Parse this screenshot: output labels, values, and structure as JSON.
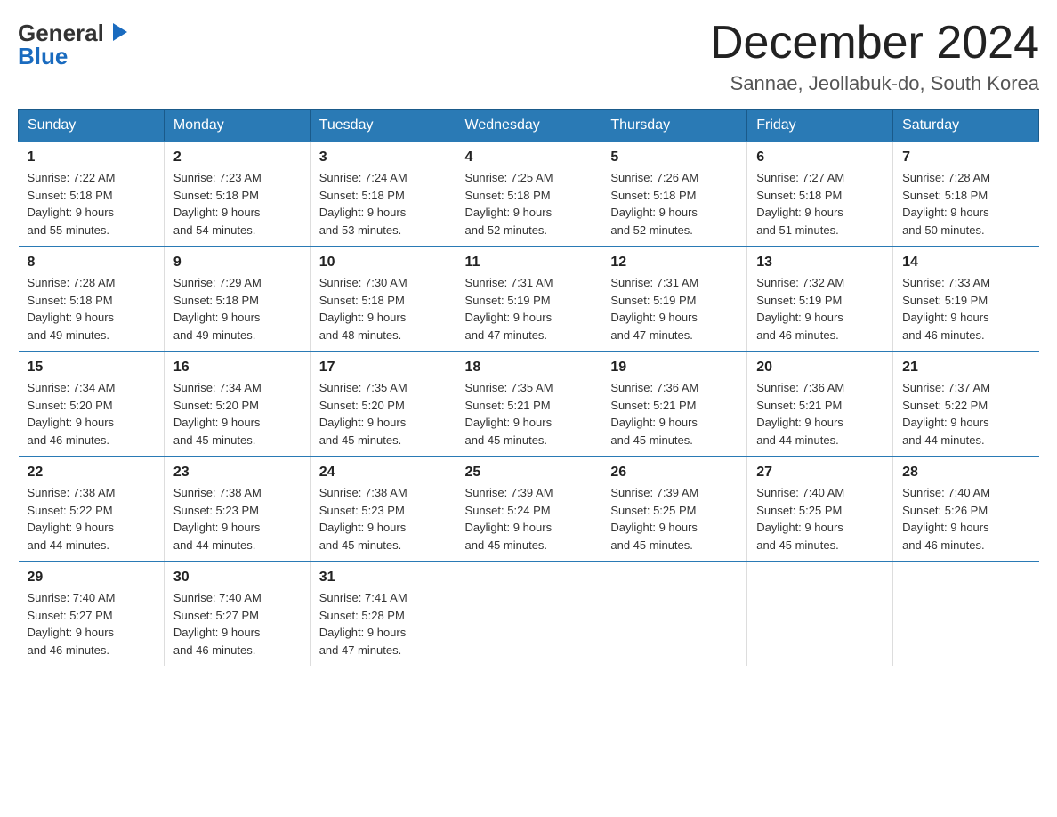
{
  "header": {
    "logo_general": "General",
    "logo_blue": "Blue",
    "month_title": "December 2024",
    "location": "Sannae, Jeollabuk-do, South Korea"
  },
  "days_of_week": [
    "Sunday",
    "Monday",
    "Tuesday",
    "Wednesday",
    "Thursday",
    "Friday",
    "Saturday"
  ],
  "weeks": [
    [
      {
        "day": "1",
        "sunrise": "7:22 AM",
        "sunset": "5:18 PM",
        "daylight": "9 hours and 55 minutes."
      },
      {
        "day": "2",
        "sunrise": "7:23 AM",
        "sunset": "5:18 PM",
        "daylight": "9 hours and 54 minutes."
      },
      {
        "day": "3",
        "sunrise": "7:24 AM",
        "sunset": "5:18 PM",
        "daylight": "9 hours and 53 minutes."
      },
      {
        "day": "4",
        "sunrise": "7:25 AM",
        "sunset": "5:18 PM",
        "daylight": "9 hours and 52 minutes."
      },
      {
        "day": "5",
        "sunrise": "7:26 AM",
        "sunset": "5:18 PM",
        "daylight": "9 hours and 52 minutes."
      },
      {
        "day": "6",
        "sunrise": "7:27 AM",
        "sunset": "5:18 PM",
        "daylight": "9 hours and 51 minutes."
      },
      {
        "day": "7",
        "sunrise": "7:28 AM",
        "sunset": "5:18 PM",
        "daylight": "9 hours and 50 minutes."
      }
    ],
    [
      {
        "day": "8",
        "sunrise": "7:28 AM",
        "sunset": "5:18 PM",
        "daylight": "9 hours and 49 minutes."
      },
      {
        "day": "9",
        "sunrise": "7:29 AM",
        "sunset": "5:18 PM",
        "daylight": "9 hours and 49 minutes."
      },
      {
        "day": "10",
        "sunrise": "7:30 AM",
        "sunset": "5:18 PM",
        "daylight": "9 hours and 48 minutes."
      },
      {
        "day": "11",
        "sunrise": "7:31 AM",
        "sunset": "5:19 PM",
        "daylight": "9 hours and 47 minutes."
      },
      {
        "day": "12",
        "sunrise": "7:31 AM",
        "sunset": "5:19 PM",
        "daylight": "9 hours and 47 minutes."
      },
      {
        "day": "13",
        "sunrise": "7:32 AM",
        "sunset": "5:19 PM",
        "daylight": "9 hours and 46 minutes."
      },
      {
        "day": "14",
        "sunrise": "7:33 AM",
        "sunset": "5:19 PM",
        "daylight": "9 hours and 46 minutes."
      }
    ],
    [
      {
        "day": "15",
        "sunrise": "7:34 AM",
        "sunset": "5:20 PM",
        "daylight": "9 hours and 46 minutes."
      },
      {
        "day": "16",
        "sunrise": "7:34 AM",
        "sunset": "5:20 PM",
        "daylight": "9 hours and 45 minutes."
      },
      {
        "day": "17",
        "sunrise": "7:35 AM",
        "sunset": "5:20 PM",
        "daylight": "9 hours and 45 minutes."
      },
      {
        "day": "18",
        "sunrise": "7:35 AM",
        "sunset": "5:21 PM",
        "daylight": "9 hours and 45 minutes."
      },
      {
        "day": "19",
        "sunrise": "7:36 AM",
        "sunset": "5:21 PM",
        "daylight": "9 hours and 45 minutes."
      },
      {
        "day": "20",
        "sunrise": "7:36 AM",
        "sunset": "5:21 PM",
        "daylight": "9 hours and 44 minutes."
      },
      {
        "day": "21",
        "sunrise": "7:37 AM",
        "sunset": "5:22 PM",
        "daylight": "9 hours and 44 minutes."
      }
    ],
    [
      {
        "day": "22",
        "sunrise": "7:38 AM",
        "sunset": "5:22 PM",
        "daylight": "9 hours and 44 minutes."
      },
      {
        "day": "23",
        "sunrise": "7:38 AM",
        "sunset": "5:23 PM",
        "daylight": "9 hours and 44 minutes."
      },
      {
        "day": "24",
        "sunrise": "7:38 AM",
        "sunset": "5:23 PM",
        "daylight": "9 hours and 45 minutes."
      },
      {
        "day": "25",
        "sunrise": "7:39 AM",
        "sunset": "5:24 PM",
        "daylight": "9 hours and 45 minutes."
      },
      {
        "day": "26",
        "sunrise": "7:39 AM",
        "sunset": "5:25 PM",
        "daylight": "9 hours and 45 minutes."
      },
      {
        "day": "27",
        "sunrise": "7:40 AM",
        "sunset": "5:25 PM",
        "daylight": "9 hours and 45 minutes."
      },
      {
        "day": "28",
        "sunrise": "7:40 AM",
        "sunset": "5:26 PM",
        "daylight": "9 hours and 46 minutes."
      }
    ],
    [
      {
        "day": "29",
        "sunrise": "7:40 AM",
        "sunset": "5:27 PM",
        "daylight": "9 hours and 46 minutes."
      },
      {
        "day": "30",
        "sunrise": "7:40 AM",
        "sunset": "5:27 PM",
        "daylight": "9 hours and 46 minutes."
      },
      {
        "day": "31",
        "sunrise": "7:41 AM",
        "sunset": "5:28 PM",
        "daylight": "9 hours and 47 minutes."
      },
      null,
      null,
      null,
      null
    ]
  ]
}
